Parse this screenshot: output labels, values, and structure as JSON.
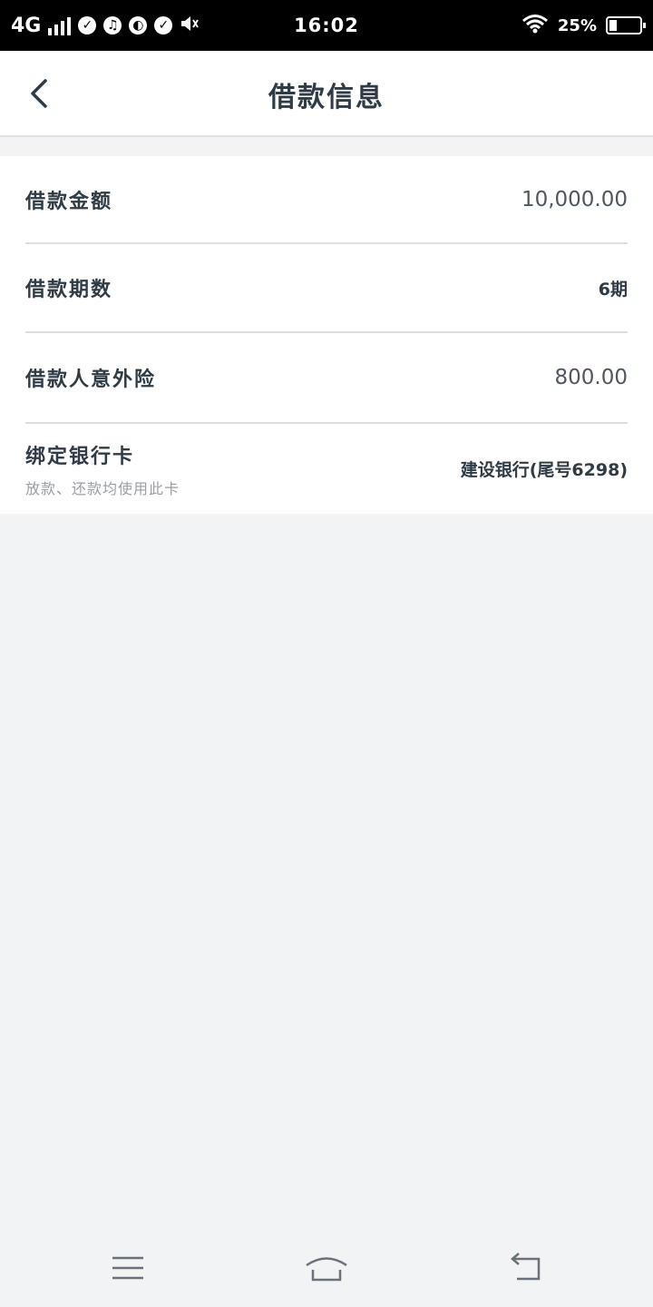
{
  "status_bar": {
    "network": "4G",
    "time": "16:02",
    "battery_percent": "25%",
    "battery_level": 0.25,
    "icons": [
      "signal-icon",
      "check-circle-icon",
      "music-app-icon",
      "planet-app-icon",
      "check-circle-icon",
      "speaker-mute-icon",
      "wifi-icon",
      "battery-icon"
    ]
  },
  "header": {
    "title": "借款信息",
    "back_icon": "chevron-left-icon"
  },
  "loan_info": {
    "amount_label": "借款金额",
    "amount_value": "10,000.00",
    "term_label": "借款期数",
    "term_value": "6期",
    "insurance_label": "借款人意外险",
    "insurance_value": "800.00",
    "bank_label": "绑定银行卡",
    "bank_hint": "放款、还款均使用此卡",
    "bank_value": "建设银行(尾号6298)"
  },
  "system_nav": {
    "icons": [
      "menu-icon",
      "home-icon",
      "back-arrow-icon"
    ]
  },
  "colors": {
    "page_background": "#f2f3f5",
    "card_background": "#ffffff",
    "primary_text": "#2f3b45",
    "secondary_text": "#9a9fa6"
  }
}
